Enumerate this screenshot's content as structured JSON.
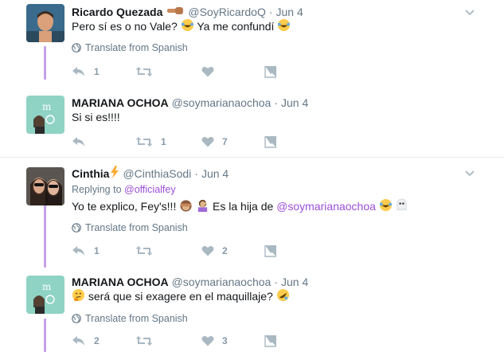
{
  "tweets": [
    {
      "name": "Ricardo Quezada",
      "handle": "@SoyRicardoQ",
      "dot": "·",
      "time": "Jun 4",
      "text_a": "Pero sí es o no Vale?",
      "text_b": "Ya me confundí",
      "translate": "Translate from Spanish",
      "reply_count": "1",
      "retweet_count": "",
      "like_count": ""
    },
    {
      "name": "MARIANA OCHOA",
      "handle": "@soymarianaochoa",
      "dot": "·",
      "time": "Jun 4",
      "text_a": "Si si es!!!!",
      "reply_count": "",
      "retweet_count": "1",
      "like_count": "7"
    },
    {
      "name": "Cinthia",
      "handle": "@CinthiaSodi",
      "dot": "·",
      "time": "Jun 4",
      "replying_label": "Replying to",
      "replying_handle": "@officialfey",
      "text_a": "Yo te explico, Fey's!!!",
      "text_b": "Es la hija de",
      "text_mention": "@soymarianaochoa",
      "translate": "Translate from Spanish",
      "reply_count": "1",
      "retweet_count": "",
      "like_count": "2"
    },
    {
      "name": "MARIANA OCHOA",
      "handle": "@soymarianaochoa",
      "dot": "·",
      "time": "Jun 4",
      "text_a": "será que si exagere en el maquillaje?",
      "translate": "Translate from Spanish",
      "reply_count": "2",
      "retweet_count": "",
      "like_count": "3"
    }
  ],
  "colors": {
    "thread_line": "#c5a0e8",
    "mention": "#9b4fd8",
    "muted": "#657786",
    "icon": "#aab8c2"
  },
  "icons": [
    "chevron-down-icon",
    "globe-icon",
    "reply-icon",
    "retweet-icon",
    "heart-icon",
    "dm-icon"
  ]
}
